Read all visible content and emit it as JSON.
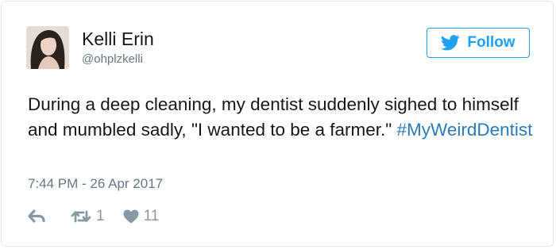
{
  "user": {
    "display_name": "Kelli Erin",
    "handle": "@ohplzkelli"
  },
  "follow_button": {
    "label": "Follow",
    "icon": "twitter-bird-icon"
  },
  "tweet": {
    "text": "During a deep cleaning, my dentist suddenly sighed to himself and mumbled sadly, \"I wanted to be a farmer.\" ",
    "hashtag": "#MyWeirdDentist",
    "timestamp": "7:44 PM - 26 Apr 2017"
  },
  "actions": {
    "reply": {
      "icon": "reply-icon"
    },
    "retweet": {
      "icon": "retweet-icon",
      "count": "1"
    },
    "like": {
      "icon": "heart-icon",
      "count": "11"
    }
  },
  "colors": {
    "accent": "#1da1f2",
    "hashtag": "#2b7bb9",
    "text": "#14171a",
    "muted": "#657786",
    "action_icons": "#8899a6"
  }
}
